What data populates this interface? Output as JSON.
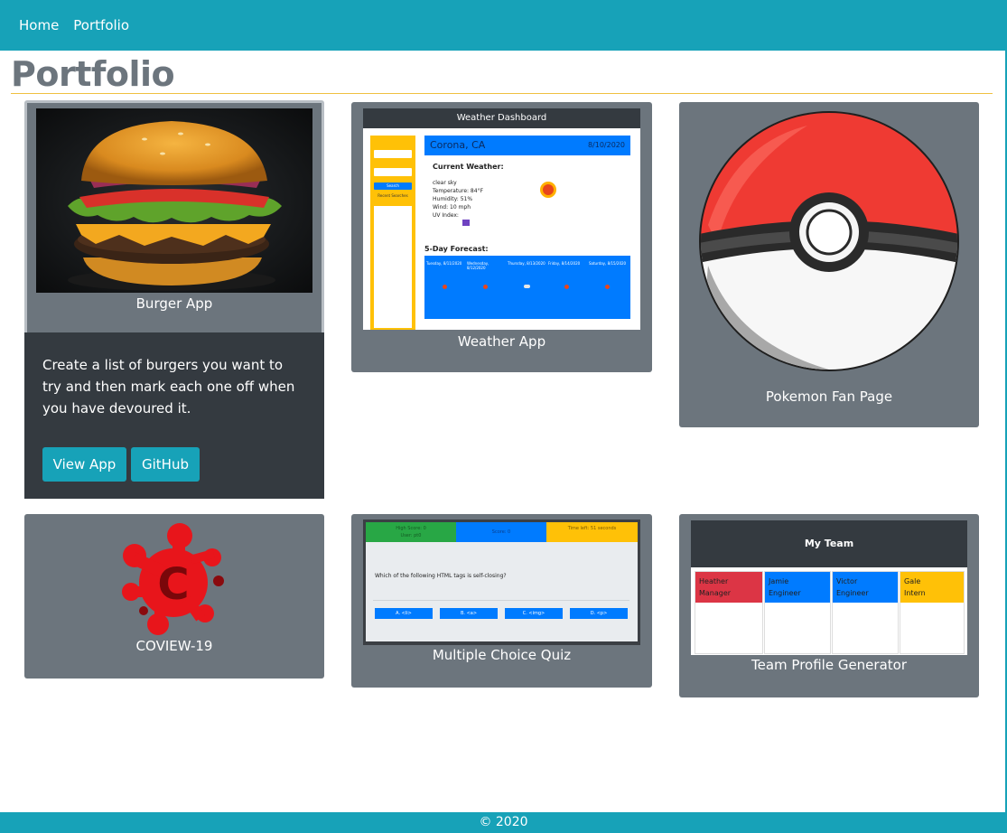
{
  "nav": {
    "home": "Home",
    "portfolio": "Portfolio"
  },
  "page": {
    "title": "Portfolio"
  },
  "projects": [
    {
      "label": "Burger App",
      "description": "Create a list of burgers you want to try and then mark each one off when you have devoured it.",
      "view_label": "View App",
      "github_label": "GitHub"
    },
    {
      "label": "Weather App",
      "screenshot": {
        "header": "Weather Dashboard",
        "city": "Corona, CA",
        "date": "8/10/2020",
        "current_label": "Current Weather:",
        "details": [
          "clear sky",
          "Temperature: 84°F",
          "Humidity: 51%",
          "Wind: 10 mph",
          "UV Index:"
        ],
        "forecast_label": "5-Day Forecast:",
        "forecast_days": [
          "Tuesday, 8/11/2020",
          "Wednesday, 8/12/2020",
          "Thursday, 8/13/2020",
          "Friday, 8/14/2020",
          "Saturday, 8/15/2020"
        ],
        "sidebar": {
          "search_label": "Search",
          "recent_label": "Recent Searches"
        }
      }
    },
    {
      "label": "Pokemon Fan Page"
    },
    {
      "label": "COVIEW-19",
      "logo_letter": "C"
    },
    {
      "label": "Multiple Choice Quiz",
      "screenshot": {
        "high_score": "High Score: 0",
        "user": "User: pt0",
        "score": "Score: 0",
        "time_left": "Time left: 51 seconds",
        "question": "Which of the following HTML tags is self-closing?",
        "answers": [
          "A. <li>",
          "B. <a>",
          "C. <img>",
          "D. <p>"
        ]
      }
    },
    {
      "label": "Team Profile Generator",
      "screenshot": {
        "header": "My Team",
        "members": [
          {
            "name": "Heather",
            "role": "Manager",
            "color": "#dc3545"
          },
          {
            "name": "Jamie",
            "role": "Engineer",
            "color": "#007bff"
          },
          {
            "name": "Victor",
            "role": "Engineer",
            "color": "#007bff"
          },
          {
            "name": "Gale",
            "role": "Intern",
            "color": "#ffc107"
          }
        ]
      }
    }
  ],
  "footer": {
    "text": "© 2020"
  },
  "colors": {
    "accent": "#17a2b8",
    "card": "#6c757d",
    "dark": "#343a40"
  }
}
